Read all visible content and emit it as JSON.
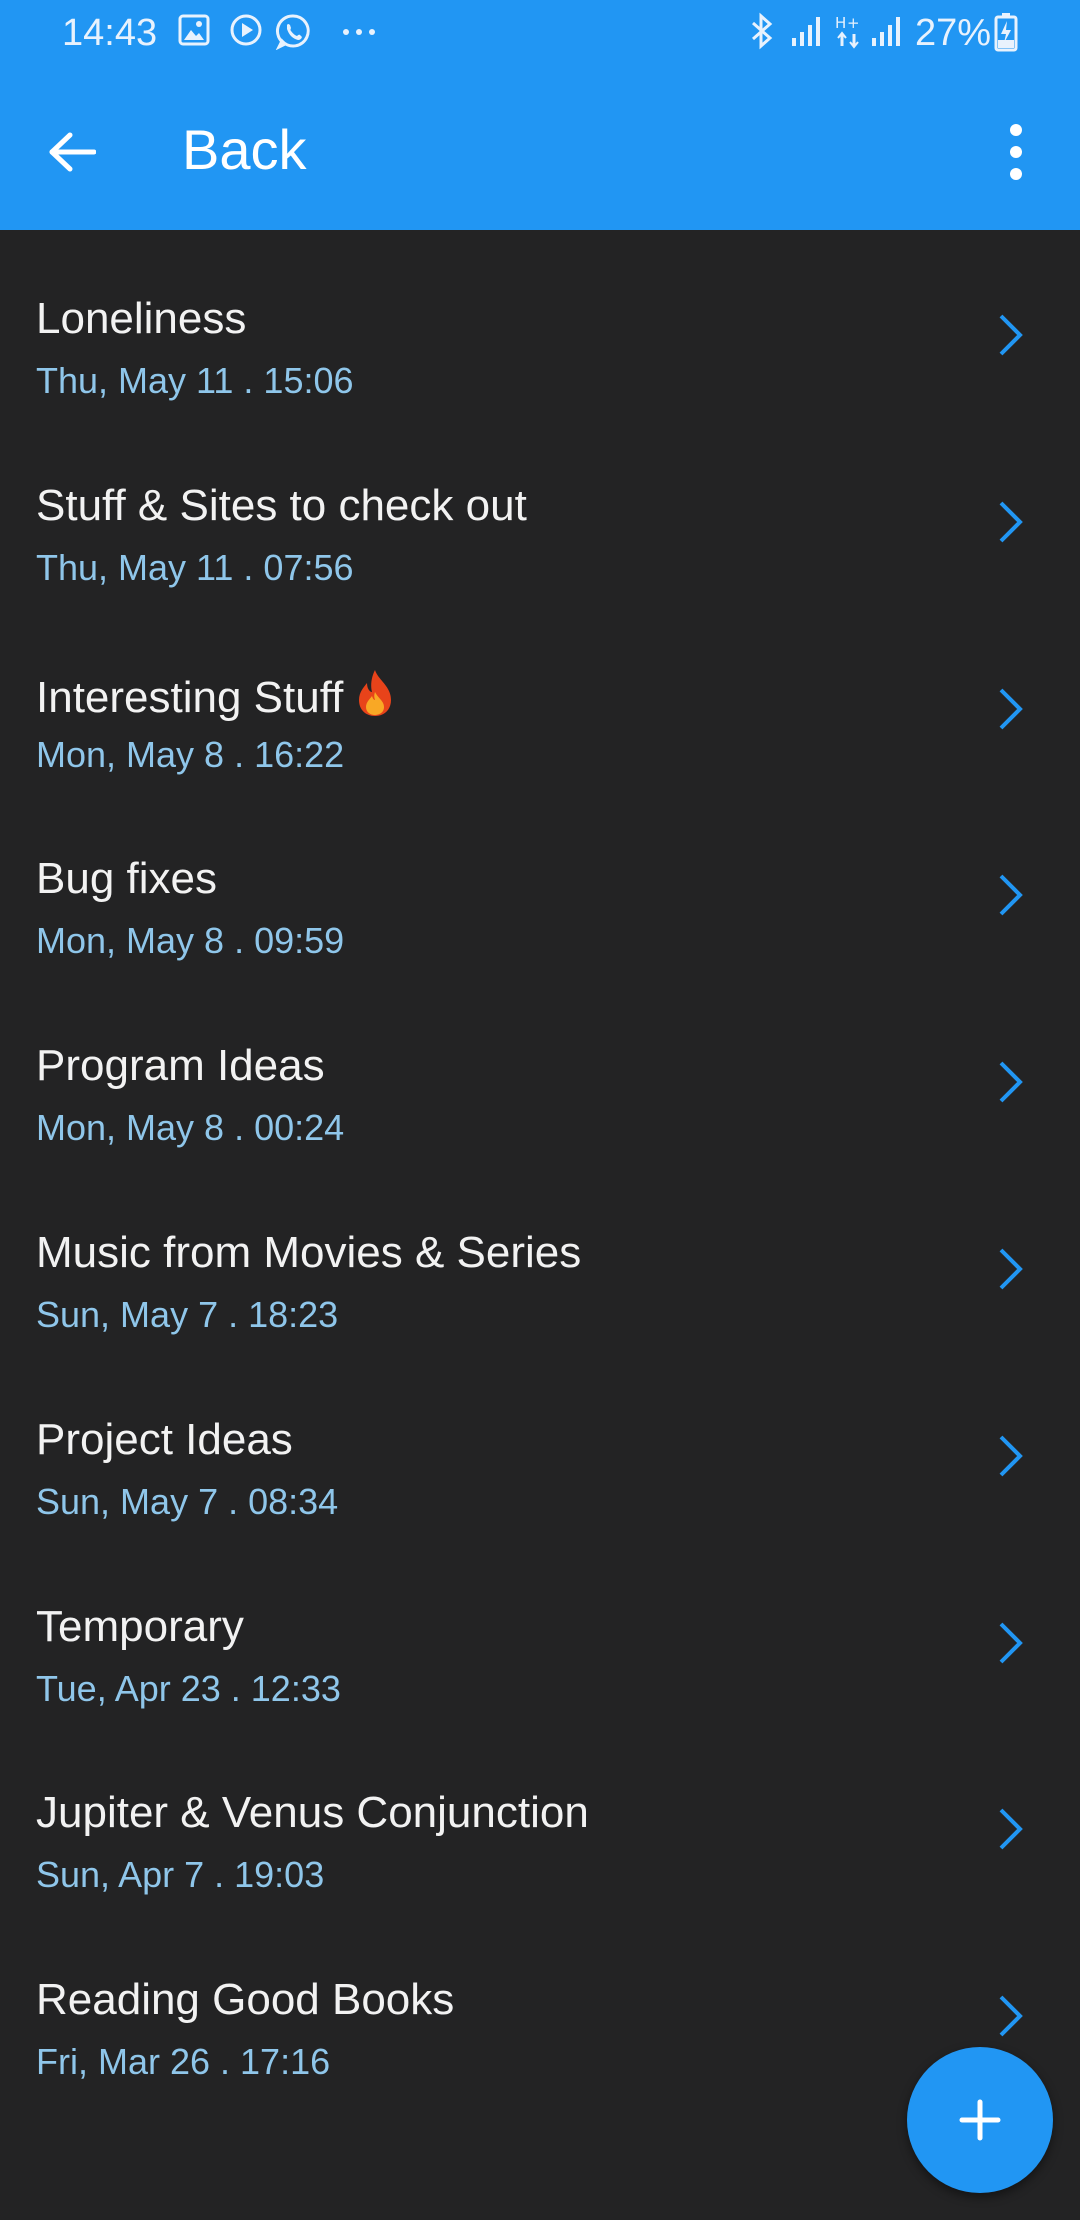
{
  "status_bar": {
    "time": "14:43",
    "battery": "27%",
    "icons": [
      "gallery-icon",
      "play-icon",
      "whatsapp-icon",
      "more-notifications-icon",
      "bluetooth-icon",
      "signal-icon",
      "data-icon",
      "signal-icon",
      "battery-charging-icon"
    ]
  },
  "app_bar": {
    "back_icon": "arrow-left-icon",
    "title": "Back",
    "menu_icon": "more-vertical-icon"
  },
  "notes": [
    {
      "title": "Loneliness",
      "date": "Thu, May 11 . 15:06"
    },
    {
      "title": "Stuff & Sites to check out",
      "date": "Thu, May 11 . 07:56"
    },
    {
      "title": "Interesting Stuff",
      "emoji": "fire-icon",
      "date": "Mon, May 8 . 16:22"
    },
    {
      "title": "Bug fixes",
      "date": "Mon, May 8 . 09:59"
    },
    {
      "title": "Program Ideas",
      "date": "Mon, May 8 . 00:24"
    },
    {
      "title": "Music from Movies & Series",
      "date": "Sun, May 7 . 18:23"
    },
    {
      "title": "Project Ideas",
      "date": "Sun, May 7 . 08:34"
    },
    {
      "title": "Temporary",
      "date": "Tue, Apr 23 . 12:33"
    },
    {
      "title": "Jupiter & Venus Conjunction",
      "date": "Sun, Apr 7 . 19:03"
    },
    {
      "title": "Reading Good Books",
      "date": "Fri, Mar 26 . 17:16"
    }
  ],
  "fab": {
    "icon": "plus-icon"
  },
  "colors": {
    "primary": "#2196f3",
    "background": "#232324",
    "title_text": "#f2f2f2",
    "date_text": "#8fc6ea",
    "chevron": "#2196f3"
  }
}
